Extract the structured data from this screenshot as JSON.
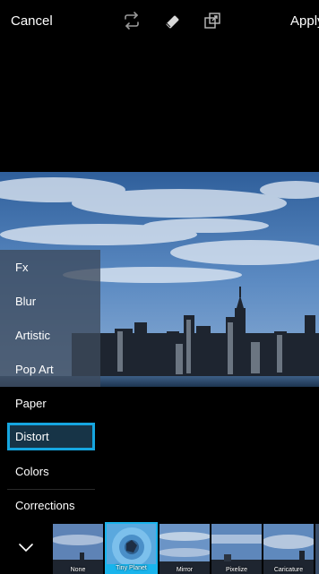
{
  "header": {
    "cancel_label": "Cancel",
    "apply_label": "Apply",
    "tools": [
      "repeat-icon",
      "eraser-icon",
      "layers-icon"
    ]
  },
  "photo": {
    "description_icon": "city-skyline-image"
  },
  "menu": {
    "items": [
      {
        "label": "Fx"
      },
      {
        "label": "Blur"
      },
      {
        "label": "Artistic"
      },
      {
        "label": "Pop Art"
      },
      {
        "label": "Paper"
      },
      {
        "label": "Distort",
        "selected": true
      },
      {
        "label": "Colors"
      },
      {
        "label": "Corrections"
      }
    ]
  },
  "effects": {
    "collapse_icon": "chevron-down-icon",
    "items": [
      {
        "label": "None"
      },
      {
        "label": "Tiny Planet",
        "selected": true
      },
      {
        "label": "Mirror"
      },
      {
        "label": "Pixelize"
      },
      {
        "label": "Caricature"
      }
    ]
  },
  "colors": {
    "accent": "#19b4ec",
    "panel": "#3e4a5c"
  }
}
